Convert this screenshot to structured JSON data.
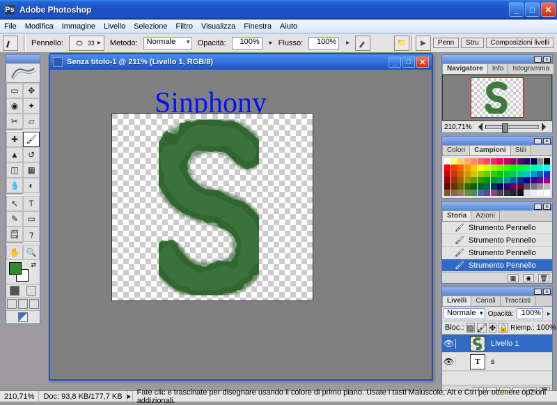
{
  "app": {
    "title": "Adobe Photoshop"
  },
  "menu": [
    "File",
    "Modifica",
    "Immagine",
    "Livello",
    "Selezione",
    "Filtro",
    "Visualizza",
    "Finestra",
    "Aiuto"
  ],
  "options": {
    "brush_label": "Pennello:",
    "brush_size": "33",
    "mode_label": "Metodo:",
    "mode_value": "Normale",
    "opacity_label": "Opacità:",
    "opacity_value": "100%",
    "flow_label": "Flusso:",
    "flow_value": "100%",
    "right_tabs": [
      "Penn",
      "Stru",
      "Composizioni livelli"
    ]
  },
  "doc": {
    "title": "Senza titolo-1 @ 211% (Livello 1, RGB/8)",
    "overlay_text": "Sinphony"
  },
  "navigator": {
    "tabs": [
      "Navigatore",
      "Info",
      "Istogramma"
    ],
    "zoom": "210,71%"
  },
  "colors_panel": {
    "tabs": [
      "Colori",
      "Campioni",
      "Stili"
    ],
    "swatches": [
      "#ffffff",
      "#ffff66",
      "#ffcc66",
      "#ffaa66",
      "#ff8866",
      "#ff6666",
      "#ff4466",
      "#ff2266",
      "#ff0066",
      "#cc0066",
      "#990066",
      "#660066",
      "#330066",
      "#000066",
      "#888888",
      "#000000",
      "#ff0000",
      "#ff3300",
      "#ff6600",
      "#ff9900",
      "#ffcc00",
      "#ffff00",
      "#ccff00",
      "#99ff00",
      "#66ff00",
      "#33ff00",
      "#00ff00",
      "#00ff33",
      "#00ff66",
      "#00ff99",
      "#00ffcc",
      "#00ffff",
      "#cc0000",
      "#cc3300",
      "#cc6600",
      "#cc9900",
      "#cccc00",
      "#99cc00",
      "#66cc00",
      "#33cc00",
      "#00cc00",
      "#00cc33",
      "#00cc66",
      "#00cc99",
      "#00cccc",
      "#0099cc",
      "#0066cc",
      "#0033cc",
      "#990000",
      "#993300",
      "#996600",
      "#999900",
      "#669900",
      "#339900",
      "#009900",
      "#009933",
      "#009966",
      "#009999",
      "#006699",
      "#003399",
      "#000099",
      "#330099",
      "#660099",
      "#990099",
      "#660000",
      "#663300",
      "#666600",
      "#336600",
      "#006600",
      "#006633",
      "#006666",
      "#003366",
      "#000066",
      "#330066",
      "#660066",
      "#660033",
      "#555555",
      "#777777",
      "#999999",
      "#bbbbbb",
      "#7a5a2a",
      "#8a6a3a",
      "#9a7a4a",
      "#6a8a4a",
      "#4a8a6a",
      "#4a6a8a",
      "#5a4a8a",
      "#8a4a6a",
      "#444444",
      "#333333",
      "#222222",
      "#111111",
      "#dedede",
      "#efefef",
      "#f8f8f8",
      "#ffffff"
    ]
  },
  "history": {
    "tabs": [
      "Storia",
      "Azioni"
    ],
    "items": [
      "Strumento Pennello",
      "Strumento Pennello",
      "Strumento Pennello",
      "Strumento Pennello"
    ],
    "selected": 3
  },
  "layers": {
    "tabs": [
      "Livelli",
      "Canali",
      "Tracciati"
    ],
    "blend_mode": "Normale",
    "opacity_label": "Opacità:",
    "opacity_value": "100%",
    "lock_label": "Bloc.:",
    "fill_label": "Riemp.:",
    "fill_value": "100%",
    "items": [
      {
        "name": "Livello 1",
        "kind": "paint",
        "selected": true
      },
      {
        "name": "s",
        "kind": "text",
        "selected": false
      }
    ]
  },
  "status": {
    "zoom": "210,71%",
    "doc_size": "Doc: 93,8 KB/177,7 KB",
    "hint": "Fate clic e trascinate per disegnare usando il colore di primo piano.  Usate i tasti Maiuscole, Alt e Ctrl per ottenere opzioni addizionali."
  }
}
